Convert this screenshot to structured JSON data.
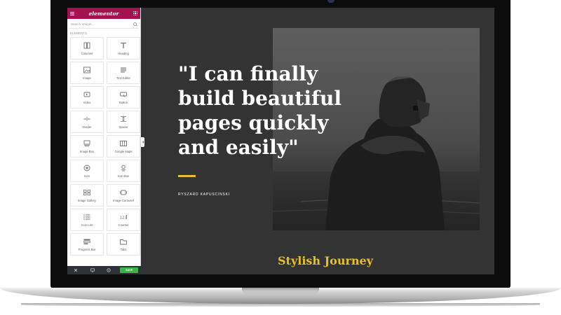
{
  "editor": {
    "logo": "elementor",
    "search_placeholder": "Search Widget...",
    "section_title": "ELEMENTS",
    "widgets": [
      {
        "label": "Columns",
        "icon": "columns-icon"
      },
      {
        "label": "Heading",
        "icon": "heading-icon"
      },
      {
        "label": "Image",
        "icon": "image-icon"
      },
      {
        "label": "Text Editor",
        "icon": "text-editor-icon"
      },
      {
        "label": "Video",
        "icon": "video-icon"
      },
      {
        "label": "Button",
        "icon": "button-icon"
      },
      {
        "label": "Divider",
        "icon": "divider-icon"
      },
      {
        "label": "Spacer",
        "icon": "spacer-icon"
      },
      {
        "label": "Image Box",
        "icon": "image-box-icon"
      },
      {
        "label": "Google Maps",
        "icon": "google-maps-icon"
      },
      {
        "label": "Icon",
        "icon": "star-icon"
      },
      {
        "label": "Icon Box",
        "icon": "icon-box-icon"
      },
      {
        "label": "Image Gallery",
        "icon": "image-gallery-icon"
      },
      {
        "label": "Image Carousel",
        "icon": "image-carousel-icon"
      },
      {
        "label": "Icon List",
        "icon": "icon-list-icon"
      },
      {
        "label": "Counter",
        "icon": "counter-icon"
      },
      {
        "label": "Progress Bar",
        "icon": "progress-bar-icon"
      },
      {
        "label": "Tabs",
        "icon": "tabs-icon"
      }
    ],
    "footer": {
      "save_label": "SAVE"
    },
    "colors": {
      "brand": "#a4114f",
      "save": "#39b54a"
    }
  },
  "canvas": {
    "quote_lines": [
      "\"I can finally",
      "build beautiful",
      "pages quickly",
      "and easily\""
    ],
    "author": "RYSZARD KAPUSCINSKI",
    "stylish_title": "Stylish Journey",
    "colors": {
      "background": "#333333",
      "accent": "#e6c028",
      "quote": "#ffffff"
    }
  }
}
